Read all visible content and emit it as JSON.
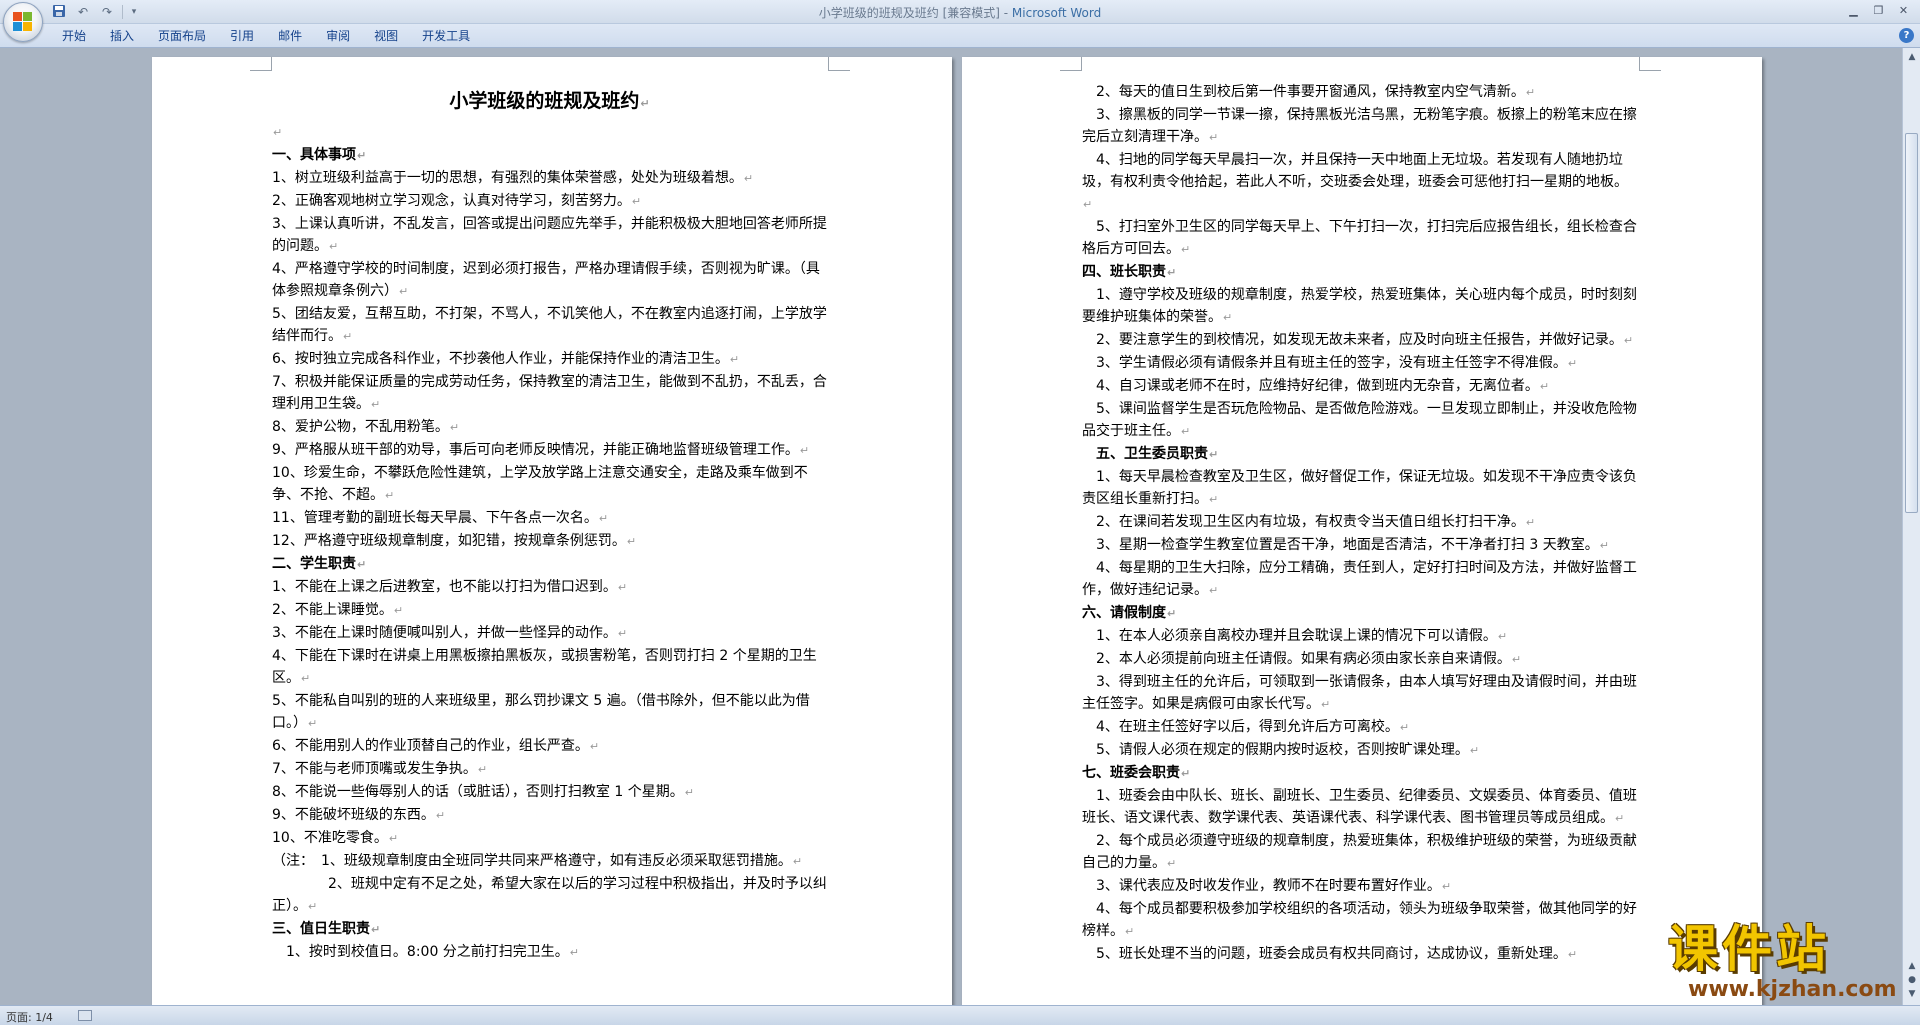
{
  "window": {
    "title_doc": "小学班级的班规及班约 [兼容模式] - ",
    "title_app": "Microsoft Word"
  },
  "quick_access": {
    "save_icon": "save-icon",
    "undo_icon": "undo-icon",
    "redo_icon": "redo-icon",
    "customize_icon": "dropdown-icon"
  },
  "ribbon": {
    "tabs": [
      "开始",
      "插入",
      "页面布局",
      "引用",
      "邮件",
      "审阅",
      "视图",
      "开发工具"
    ],
    "help": "?"
  },
  "document": {
    "page1": {
      "title": "小学班级的班规及班约",
      "paragraphs": [
        {
          "text": "",
          "bold": false
        },
        {
          "text": "一、具体事项",
          "bold": true
        },
        {
          "text": "1、树立班级利益高于一切的思想，有强烈的集体荣誉感，处处为班级着想。",
          "bold": false
        },
        {
          "text": "2、正确客观地树立学习观念，认真对待学习，刻苦努力。",
          "bold": false
        },
        {
          "text": "3、上课认真听讲，不乱发言，回答或提出问题应先举手，并能积极极大胆地回答老师所提的问题。",
          "bold": false
        },
        {
          "text": "4、严格遵守学校的时间制度，迟到必须打报告，严格办理请假手续，否则视为旷课。（具体参照规章条例六）",
          "bold": false
        },
        {
          "text": "5、团结友爱，互帮互助，不打架，不骂人，不讥笑他人，不在教室内追逐打闹，上学放学结伴而行。",
          "bold": false
        },
        {
          "text": "6、按时独立完成各科作业，不抄袭他人作业，并能保持作业的清洁卫生。",
          "bold": false
        },
        {
          "text": "7、积极并能保证质量的完成劳动任务，保持教室的清洁卫生，能做到不乱扔，不乱丢，合理利用卫生袋。",
          "bold": false
        },
        {
          "text": "8、爱护公物，不乱用粉笔。",
          "bold": false
        },
        {
          "text": "9、严格服从班干部的劝导，事后可向老师反映情况，并能正确地监督班级管理工作。",
          "bold": false
        },
        {
          "text": "10、珍爱生命，不攀跃危险性建筑，上学及放学路上注意交通安全，走路及乘车做到不争、不抢、不超。",
          "bold": false
        },
        {
          "text": "11、管理考勤的副班长每天早晨、下午各点一次名。",
          "bold": false
        },
        {
          "text": "12、严格遵守班级规章制度，如犯错，按规章条例惩罚。",
          "bold": false
        },
        {
          "text": "二、学生职责",
          "bold": true
        },
        {
          "text": "1、不能在上课之后进教室，也不能以打扫为借口迟到。",
          "bold": false
        },
        {
          "text": "2、不能上课睡觉。",
          "bold": false
        },
        {
          "text": "3、不能在上课时随便喊叫别人，并做一些怪异的动作。",
          "bold": false
        },
        {
          "text": "4、下能在下课时在讲桌上用黑板擦拍黑板灰，或损害粉笔，否则罚打扫 2 个星期的卫生区。",
          "bold": false
        },
        {
          "text": "5、不能私自叫别的班的人来班级里，那么罚抄课文 5 遍。（借书除外，但不能以此为借口。）",
          "bold": false
        },
        {
          "text": "6、不能用别人的作业顶替自己的作业，组长严查。",
          "bold": false
        },
        {
          "text": "7、不能与老师顶嘴或发生争执。",
          "bold": false
        },
        {
          "text": "8、不能说一些侮辱别人的话（或脏话），否则打扫教室 1 个星期。",
          "bold": false
        },
        {
          "text": "9、不能破坏班级的东西。",
          "bold": false
        },
        {
          "text": "10、不准吃零食。",
          "bold": false
        },
        {
          "text": "（注：　1、班级规章制度由全班同学共同来严格遵守，如有违反必须采取惩罚措施。",
          "bold": false
        },
        {
          "text": "　　　　2、班规中定有不足之处，希望大家在以后的学习过程中积极指出，并及时予以纠正）。",
          "bold": false
        },
        {
          "text": "三、值日生职责",
          "bold": true
        },
        {
          "text": "　1、按时到校值日。8:00 分之前打扫完卫生。",
          "bold": false
        }
      ]
    },
    "page2": {
      "paragraphs": [
        {
          "text": "　2、每天的值日生到校后第一件事要开窗通风，保持教室内空气清新。",
          "bold": false
        },
        {
          "text": "　3、擦黑板的同学一节课一擦，保持黑板光洁乌黑，无粉笔字痕。板擦上的粉笔末应在擦完后立刻清理干净。",
          "bold": false
        },
        {
          "text": "　4、扫地的同学每天早晨扫一次，并且保持一天中地面上无垃圾。若发现有人随地扔垃圾，有权利责令他拾起，若此人不听，交班委会处理，班委会可惩他打扫一星期的地板。",
          "bold": false
        },
        {
          "text": "　5、打扫室外卫生区的同学每天早上、下午打扫一次，打扫完后应报告组长，组长检查合格后方可回去。",
          "bold": false
        },
        {
          "text": "四、班长职责",
          "bold": true
        },
        {
          "text": "　1、遵守学校及班级的规章制度，热爱学校，热爱班集体，关心班内每个成员，时时刻刻要维护班集体的荣誉。",
          "bold": false
        },
        {
          "text": "　2、要注意学生的到校情况，如发现无故未来者，应及时向班主任报告，并做好记录。",
          "bold": false
        },
        {
          "text": "　3、学生请假必须有请假条并且有班主任的签字，没有班主任签字不得准假。",
          "bold": false
        },
        {
          "text": "　4、自习课或老师不在时，应维持好纪律，做到班内无杂音，无离位者。",
          "bold": false
        },
        {
          "text": "　5、课间监督学生是否玩危险物品、是否做危险游戏。一旦发现立即制止，并没收危险物品交于班主任。",
          "bold": false
        },
        {
          "text": "　五、卫生委员职责",
          "bold": true
        },
        {
          "text": "　1、每天早晨检查教室及卫生区，做好督促工作，保证无垃圾。如发现不干净应责令该负责区组长重新打扫。",
          "bold": false
        },
        {
          "text": "　2、在课间若发现卫生区内有垃圾，有权责令当天值日组长打扫干净。",
          "bold": false
        },
        {
          "text": "　3、星期一检查学生教室位置是否干净，地面是否清洁，不干净者打扫 3 天教室。",
          "bold": false
        },
        {
          "text": "　4、每星期的卫生大扫除，应分工精确，责任到人，定好打扫时间及方法，并做好监督工作，做好违纪记录。",
          "bold": false
        },
        {
          "text": "六、请假制度",
          "bold": true
        },
        {
          "text": "　1、在本人必须亲自离校办理并且会耽误上课的情况下可以请假。",
          "bold": false
        },
        {
          "text": "　2、本人必须提前向班主任请假。如果有病必须由家长亲自来请假。",
          "bold": false
        },
        {
          "text": "　3、得到班主任的允许后，可领取到一张请假条，由本人填写好理由及请假时间，并由班主任签字。如果是病假可由家长代写。",
          "bold": false
        },
        {
          "text": "　4、在班主任签好字以后，得到允许后方可离校。",
          "bold": false
        },
        {
          "text": "　5、请假人必须在规定的假期内按时返校，否则按旷课处理。",
          "bold": false
        },
        {
          "text": "七、班委会职责",
          "bold": true
        },
        {
          "text": "　1、班委会由中队长、班长、副班长、卫生委员、纪律委员、文娱委员、体育委员、值班班长、语文课代表、数学课代表、英语课代表、科学课代表、图书管理员等成员组成。",
          "bold": false
        },
        {
          "text": "　2、每个成员必须遵守班级的规章制度，热爱班集体，积极维护班级的荣誉，为班级贡献自己的力量。",
          "bold": false
        },
        {
          "text": "　3、课代表应及时收发作业，教师不在时要布置好作业。",
          "bold": false
        },
        {
          "text": "　4、每个成员都要积极参加学校组织的各项活动，领头为班级争取荣誉，做其他同学的好榜样。",
          "bold": false
        },
        {
          "text": "　5、班长处理不当的问题，班委会成员有权共同商讨，达成协议，重新处理。",
          "bold": false
        }
      ]
    },
    "paragraph_mark": "↵"
  },
  "status_bar": {
    "page_info": "页面: 1/4"
  },
  "watermark": {
    "text": "课件站",
    "url": "www.kjzhan.com"
  }
}
